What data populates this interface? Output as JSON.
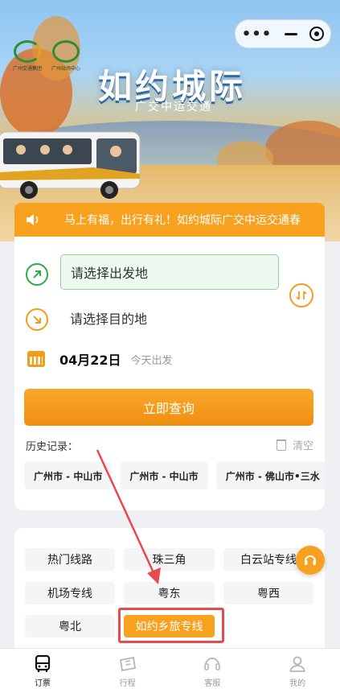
{
  "hero": {
    "logo1_caption": "广州交通集团",
    "logo2_caption": "广州站场中心",
    "title": "如约城际",
    "subtitle": "广交中运交通"
  },
  "notice": {
    "icon": "speaker-icon",
    "text": "马上有福，出行有礼！如约城际广交中运交通春"
  },
  "search": {
    "from_placeholder": "请选择出发地",
    "to_placeholder": "请选择目的地",
    "date": "04月22日",
    "date_hint": "今天出发",
    "query_button": "立即查询",
    "history_label": "历史记录：",
    "clear_label": "清空",
    "history": [
      "广州市 - 中山市",
      "广州市 - 中山市",
      "广州市 - 佛山市•三水"
    ]
  },
  "routes": {
    "chips": [
      "热门线路",
      "珠三角",
      "白云站专线",
      "机场专线",
      "粤东",
      "粤西",
      "粤北",
      "如约乡旅专线"
    ],
    "active_index": 7
  },
  "tabbar": {
    "items": [
      {
        "label": "订票",
        "icon": "bus-icon",
        "active": true
      },
      {
        "label": "行程",
        "icon": "ticket-icon",
        "active": false
      },
      {
        "label": "客服",
        "icon": "headset-icon",
        "active": false
      },
      {
        "label": "我的",
        "icon": "user-icon",
        "active": false
      }
    ]
  },
  "colors": {
    "accent": "#f7a11f",
    "green": "#2fab4b",
    "annotation_red": "#e8494c"
  }
}
